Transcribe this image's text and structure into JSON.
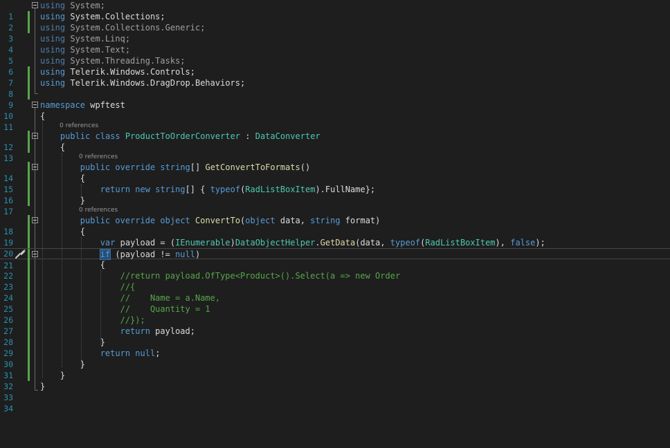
{
  "editor": {
    "line_numbers": [
      "1",
      "2",
      "3",
      "4",
      "5",
      "6",
      "7",
      "8",
      "9",
      "10",
      "11",
      "12",
      "13",
      "14",
      "15",
      "16",
      "17",
      "18",
      "19",
      "20",
      "21",
      "22",
      "23",
      "24",
      "25",
      "26",
      "27",
      "28",
      "29",
      "30",
      "31",
      "32",
      "33",
      "34"
    ],
    "codelens": {
      "l12": "0 references",
      "l14": "0 references",
      "l18": "0 references"
    },
    "code": {
      "l1_kw": "using",
      "l1_rest": " System;",
      "l2_kw": "using",
      "l2_rest": " System.Collections;",
      "l3_kw": "using",
      "l3_rest": " System.Collections.Generic;",
      "l4_kw": "using",
      "l4_rest": " System.Linq;",
      "l5_kw": "using",
      "l5_rest": " System.Text;",
      "l6_kw": "using",
      "l6_rest": " System.Threading.Tasks;",
      "l7_kw": "using",
      "l7_rest": " Telerik.Windows.Controls;",
      "l8_kw": "using",
      "l8_rest": " Telerik.Windows.DragDrop.Behaviors;",
      "l10_kw": "namespace",
      "l10_rest": " wpftest",
      "l11": "{",
      "l12_indent": "    ",
      "l12_kw1": "public",
      "l12_kw2": "class",
      "l12_name": "ProductToOrderConverter",
      "l12_colon": " : ",
      "l12_base": "DataConverter",
      "l13": "    {",
      "l14_indent": "        ",
      "l14_kw1": "public",
      "l14_kw2": "override",
      "l14_kw3": "string",
      "l14_arr": "[] ",
      "l14_fn": "GetConvertToFormats",
      "l14_end": "()",
      "l15": "        {",
      "l16_indent": "            ",
      "l16_kw1": "return",
      "l16_kw2": "new",
      "l16_kw3": "string",
      "l16_mid": "[] { ",
      "l16_kw4": "typeof",
      "l16_p1": "(",
      "l16_ty": "RadListBoxItem",
      "l16_end": ").FullName};",
      "l17": "        }",
      "l18_indent": "        ",
      "l18_kw1": "public",
      "l18_kw2": "override",
      "l18_kw3": "object",
      "l18_fn": "ConvertTo",
      "l18_p1": "(",
      "l18_kw4": "object",
      "l18_p2": " data, ",
      "l18_kw5": "string",
      "l18_end": " format)",
      "l19": "        {",
      "l20_indent": "            ",
      "l20_kw1": "var",
      "l20_a": " payload = (",
      "l20_ty1": "IEnumerable",
      "l20_b": ")",
      "l20_ty2": "DataObjectHelper",
      "l20_c": ".",
      "l20_fn": "GetData",
      "l20_d": "(data, ",
      "l20_kw2": "typeof",
      "l20_e": "(",
      "l20_ty3": "RadListBoxItem",
      "l20_f": "), ",
      "l20_kw3": "false",
      "l20_end": ");",
      "l21_indent": "            ",
      "l21_kw1": "if",
      "l21_a": " (payload != ",
      "l21_kw2": "null",
      "l21_end": ")",
      "l22": "            {",
      "l23_indent": "                ",
      "l23_cm": "//return payload.OfType<Product>().Select(a => new Order",
      "l24_cm": "//{",
      "l25_cm": "//    Name = a.Name,",
      "l26_cm": "//    Quantity = 1",
      "l27_cm": "//});",
      "l28_kw": "return",
      "l28_rest": " payload;",
      "l29": "            }",
      "l30_indent": "            ",
      "l30_kw1": "return",
      "l30_kw2": "null",
      "l30_end": ";",
      "l31": "        }",
      "l32": "    }",
      "l33": "}"
    },
    "colors": {
      "background": "#1e1e1e",
      "keyword": "#569cd6",
      "type": "#4ec9b0",
      "method": "#dcdcaa",
      "comment": "#57a64a",
      "line_number": "#2b91af",
      "change_bar": "#57a64a"
    },
    "icons": {
      "quick_actions": "screwdriver-brush-icon",
      "fold": "collapse-minus-icon"
    }
  }
}
